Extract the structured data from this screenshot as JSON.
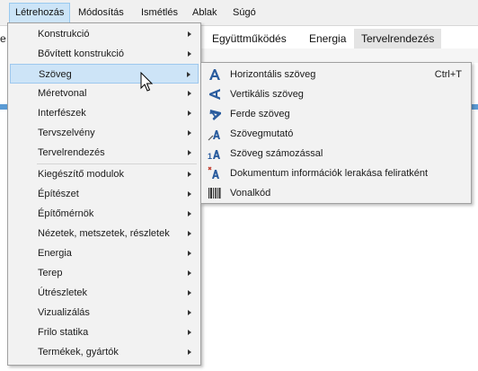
{
  "menubar": {
    "items": [
      "Létrehozás",
      "Módosítás",
      "Ismétlés",
      "Ablak",
      "Súgó"
    ]
  },
  "background": {
    "tabs": [
      "Együttműködés",
      "Energia",
      "Tervelrendezés"
    ],
    "left_fragment": "e"
  },
  "menu": {
    "items": [
      "Konstrukció",
      "Bővített konstrukció",
      "Szöveg",
      "Méretvonal",
      "Interfészek",
      "Tervszelvény",
      "Tervelrendezés",
      "Kiegészítő modulok",
      "Építészet",
      "Építőmérnök",
      "Nézetek, metszetek, részletek",
      "Energia",
      "Terep",
      "Útrészletek",
      "Vizualizálás",
      "Frilo statika",
      "Termékek, gyártók"
    ],
    "highlighted": "Szöveg"
  },
  "submenu": {
    "items": [
      {
        "label": "Horizontális szöveg",
        "shortcut": "Ctrl+T",
        "icon": "text-horizontal-icon"
      },
      {
        "label": "Vertikális szöveg",
        "shortcut": "",
        "icon": "text-vertical-icon"
      },
      {
        "label": "Ferde szöveg",
        "shortcut": "",
        "icon": "text-slanted-icon"
      },
      {
        "label": "Szövegmutató",
        "shortcut": "",
        "icon": "text-pointer-icon"
      },
      {
        "label": "Szöveg számozással",
        "shortcut": "",
        "icon": "text-numbered-icon"
      },
      {
        "label": "Dokumentum információk lerakása feliratként",
        "shortcut": "",
        "icon": "document-info-label-icon"
      },
      {
        "label": "Vonalkód",
        "shortcut": "",
        "icon": "barcode-icon"
      }
    ]
  },
  "colors": {
    "highlight_bg": "#cde4f7",
    "highlight_border": "#9ec8ee",
    "icon_blue": "#2a5c9e"
  }
}
